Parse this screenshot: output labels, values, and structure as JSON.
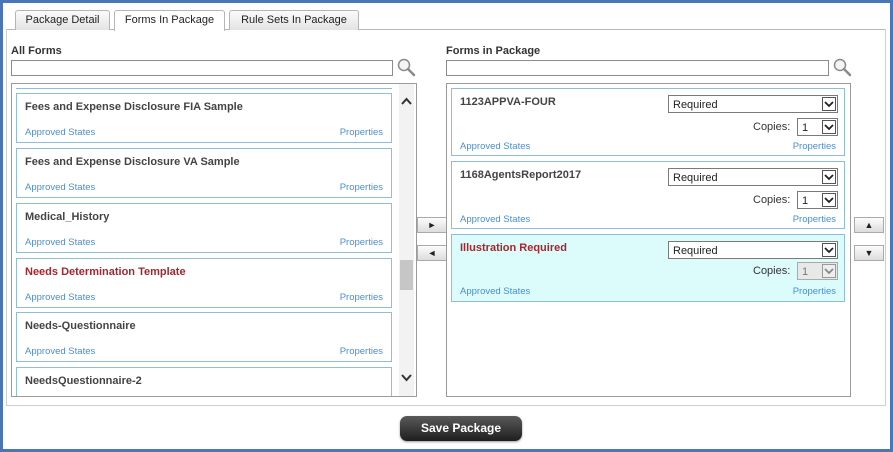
{
  "tabs": [
    {
      "label": "Package Detail"
    },
    {
      "label": "Forms In Package"
    },
    {
      "label": "Rule Sets In Package"
    }
  ],
  "all_forms": {
    "title": "All Forms",
    "search_value": "",
    "items": [
      {
        "name": "Fees and Expense Disclosure FIA Sample",
        "approved": "Approved States",
        "properties": "Properties"
      },
      {
        "name": "Fees and Expense Disclosure VA Sample",
        "approved": "Approved States",
        "properties": "Properties"
      },
      {
        "name": "Medical_History",
        "approved": "Approved States",
        "properties": "Properties"
      },
      {
        "name": "Needs Determination Template",
        "approved": "Approved States",
        "properties": "Properties"
      },
      {
        "name": "Needs-Questionnaire",
        "approved": "Approved States",
        "properties": "Properties"
      },
      {
        "name": "NeedsQuestionnaire-2",
        "approved": "",
        "properties": ""
      }
    ]
  },
  "forms_in_package": {
    "title": "Forms in Package",
    "search_value": "",
    "copies_label": "Copies:",
    "items": [
      {
        "name": "1123APPVA-FOUR",
        "requirement": "Required",
        "copies": "1",
        "approved": "Approved States",
        "properties": "Properties"
      },
      {
        "name": "1168AgentsReport2017",
        "requirement": "Required",
        "copies": "1",
        "approved": "Approved States",
        "properties": "Properties"
      },
      {
        "name": "Illustration Required",
        "requirement": "Required",
        "copies": "1",
        "approved": "Approved States",
        "properties": "Properties"
      }
    ]
  },
  "movers": {
    "add": "►",
    "remove": "◄",
    "up": "▲",
    "down": "▼"
  },
  "save_label": "Save Package",
  "colors": {
    "frame_border": "#4a76b8",
    "card_border": "#8fbfd8",
    "link": "#4a8fd0",
    "required_red": "#a3272d",
    "selected_bg": "#dcfbfb"
  }
}
